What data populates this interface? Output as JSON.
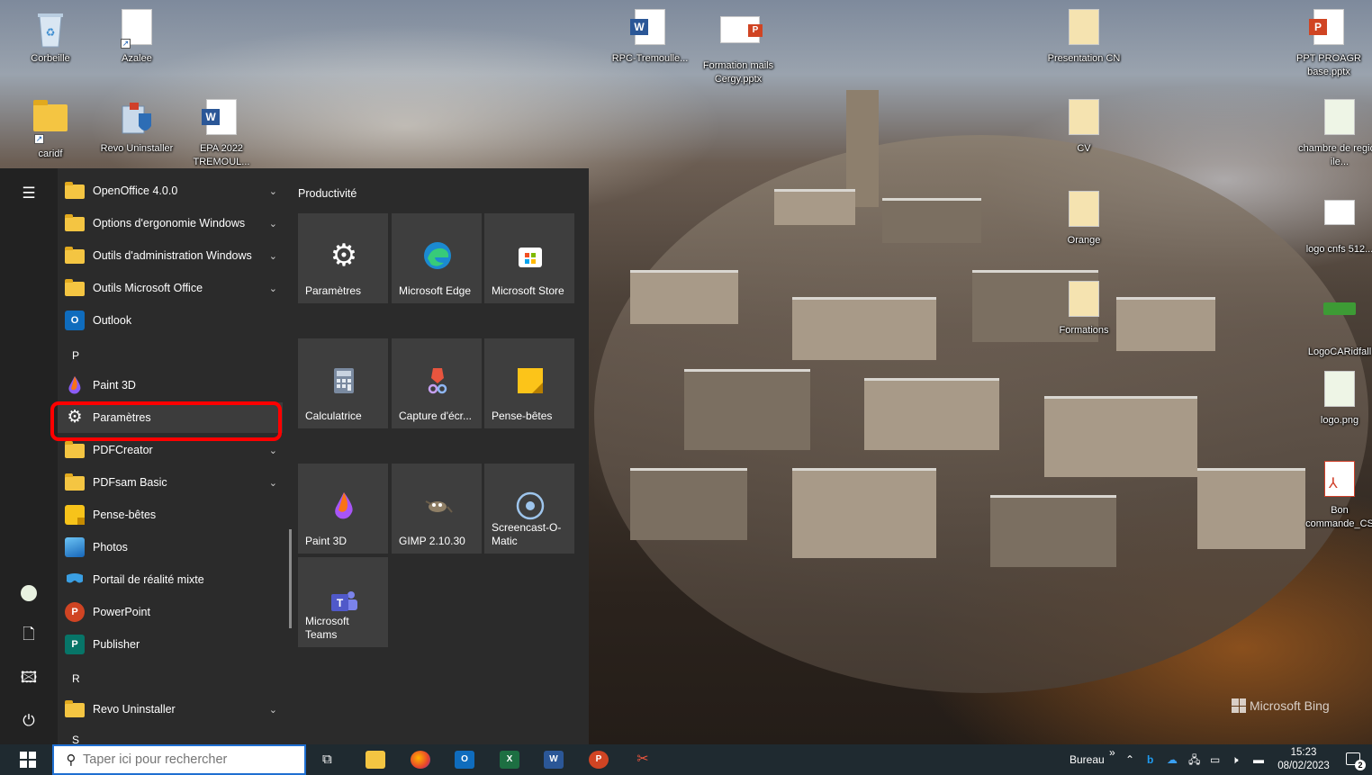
{
  "desktop": {
    "icons": [
      {
        "label": "Corbeille"
      },
      {
        "label": "Azalee"
      },
      {
        "label": "RPC-Tremoulle..."
      },
      {
        "label": "Formation mails Cergy.pptx"
      },
      {
        "label": "Presentation CN"
      },
      {
        "label": "PPT PROAGR base.pptx"
      },
      {
        "label": "caridf"
      },
      {
        "label": "Revo Uninstaller"
      },
      {
        "label": "EPA 2022 TREMOUL..."
      },
      {
        "label": "CV"
      },
      {
        "label": "chambre de region ile..."
      },
      {
        "label": "Orange"
      },
      {
        "label": "logo cnfs 512..."
      },
      {
        "label": "Formations"
      },
      {
        "label": "LogoCARidfall"
      },
      {
        "label": "logo.png"
      },
      {
        "label": "Bon commande_CS"
      }
    ],
    "watermark": "Microsoft Bing"
  },
  "start_menu": {
    "apps": [
      {
        "label": "OpenOffice 4.0.0",
        "icon": "folder-icon",
        "expandable": true
      },
      {
        "label": "Options d'ergonomie Windows",
        "icon": "folder-icon",
        "expandable": true
      },
      {
        "label": "Outils d'administration Windows",
        "icon": "folder-icon",
        "expandable": true
      },
      {
        "label": "Outils Microsoft Office",
        "icon": "folder-icon",
        "expandable": true
      },
      {
        "label": "Outlook",
        "icon": "outlook-icon",
        "expandable": false
      },
      {
        "label": "Paint 3D",
        "icon": "paint3d-icon",
        "expandable": false
      },
      {
        "label": "Paramètres",
        "icon": "gear-icon",
        "expandable": false
      },
      {
        "label": "PDFCreator",
        "icon": "folder-icon",
        "expandable": true
      },
      {
        "label": "PDFsam Basic",
        "icon": "folder-icon",
        "expandable": true
      },
      {
        "label": "Pense-bêtes",
        "icon": "sticky-notes-icon",
        "expandable": false
      },
      {
        "label": "Photos",
        "icon": "photos-icon",
        "expandable": false
      },
      {
        "label": "Portail de réalité mixte",
        "icon": "mixed-reality-icon",
        "expandable": false
      },
      {
        "label": "PowerPoint",
        "icon": "powerpoint-icon",
        "expandable": false
      },
      {
        "label": "Publisher",
        "icon": "publisher-icon",
        "expandable": false
      },
      {
        "label": "Revo Uninstaller",
        "icon": "folder-icon",
        "expandable": true
      }
    ],
    "letters": {
      "p": "P",
      "r": "R",
      "s": "S"
    },
    "tiles_header": "Productivité",
    "tiles": [
      {
        "label": "Paramètres",
        "icon": "gear-icon"
      },
      {
        "label": "Microsoft Edge",
        "icon": "edge-icon"
      },
      {
        "label": "Microsoft Store",
        "icon": "store-icon"
      },
      {
        "label": "Calculatrice",
        "icon": "calculator-icon"
      },
      {
        "label": "Capture d'écr...",
        "icon": "snip-icon"
      },
      {
        "label": "Pense-bêtes",
        "icon": "sticky-notes-icon"
      },
      {
        "label": "Paint 3D",
        "icon": "paint3d-icon"
      },
      {
        "label": "GIMP 2.10.30",
        "icon": "gimp-icon"
      },
      {
        "label": "Screencast-O-Matic",
        "icon": "screencast-icon"
      },
      {
        "label": "Microsoft Teams",
        "icon": "teams-icon"
      }
    ]
  },
  "taskbar": {
    "search_placeholder": "Taper ici pour rechercher",
    "tray_label": "Bureau",
    "tray_chevron": "»",
    "time": "15:23",
    "date": "08/02/2023",
    "notification_count": "2"
  },
  "colors": {
    "highlight": "#ff0000",
    "taskbar": "#1f2a30",
    "start_bg": "#2b2b2b",
    "tile_bg": "#3e3e3e"
  }
}
